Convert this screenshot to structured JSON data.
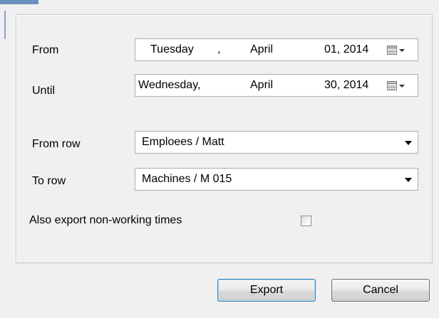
{
  "form": {
    "from_label": "From",
    "until_label": "Until",
    "from_row_label": "From row",
    "to_row_label": "To row",
    "nonworking_label": "Also export non-working times"
  },
  "from_date": {
    "weekday": "Tuesday",
    "separator": ",",
    "month": "April",
    "day_year": "01, 2014",
    "icon": "calendar-dropdown-icon"
  },
  "until_date": {
    "weekday": "Wednesday,",
    "month": "April",
    "day_year": "30, 2014",
    "icon": "calendar-dropdown-icon"
  },
  "from_row": {
    "value": "Emploees / Matt",
    "icon": "chevron-down-icon"
  },
  "to_row": {
    "value": "Machines / M 015",
    "icon": "chevron-down-icon"
  },
  "nonworking_checked": false,
  "buttons": {
    "export_label": "Export",
    "cancel_label": "Cancel"
  },
  "colors": {
    "window_bg": "#f0f0f0",
    "field_border": "#abadb3",
    "default_button_border": "#3c7fb1"
  }
}
